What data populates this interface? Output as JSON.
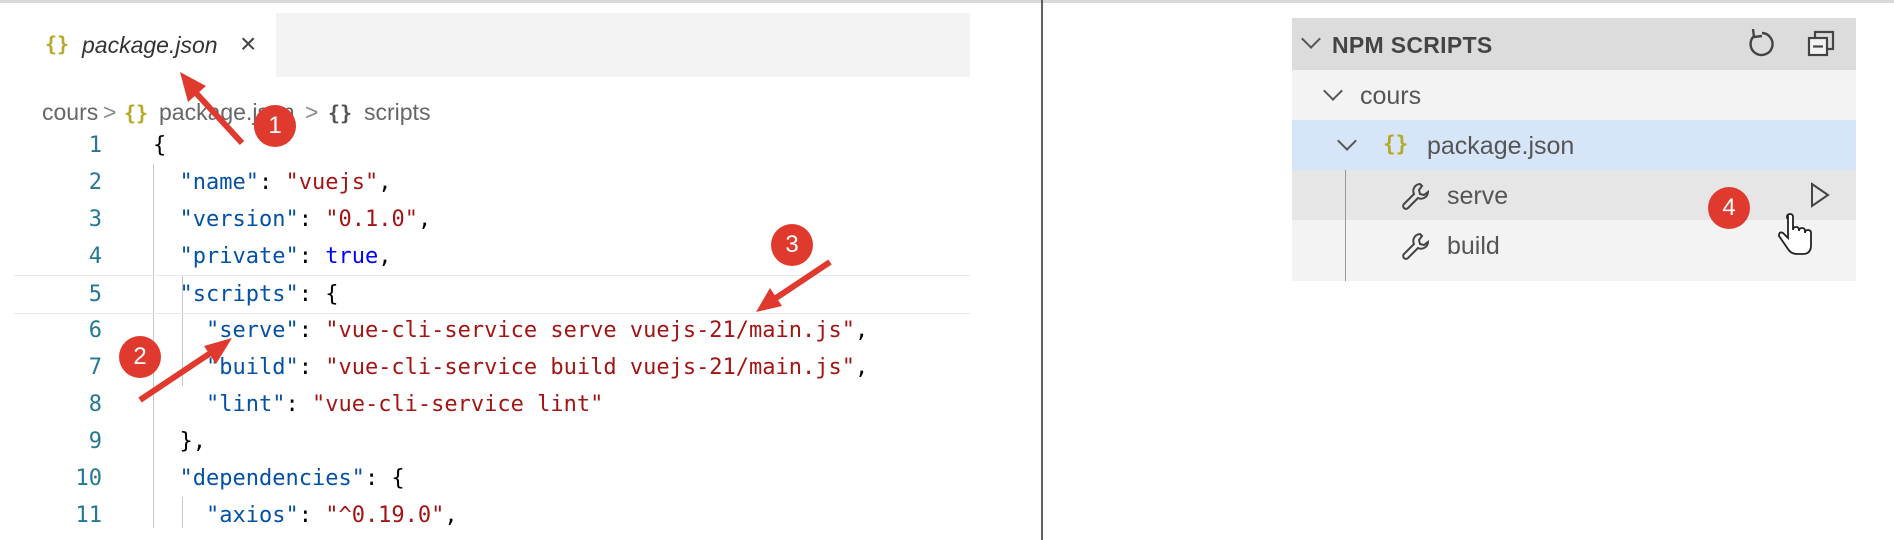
{
  "editor": {
    "tab": {
      "icon": "{}",
      "filename": "package.json",
      "close": "×"
    },
    "breadcrumb": {
      "folder": "cours",
      "file_icon": "{}",
      "file": "package.json",
      "section_icon": "{}",
      "section": "scripts",
      "separator": ">"
    },
    "lines": [
      {
        "n": "1",
        "parts": [
          [
            "p",
            "{"
          ]
        ]
      },
      {
        "n": "2",
        "parts": [
          [
            "p",
            "  "
          ],
          [
            "k",
            "\"name\""
          ],
          [
            "p",
            ": "
          ],
          [
            "s",
            "\"vuejs\""
          ],
          [
            "p",
            ","
          ]
        ]
      },
      {
        "n": "3",
        "parts": [
          [
            "p",
            "  "
          ],
          [
            "k",
            "\"version\""
          ],
          [
            "p",
            ": "
          ],
          [
            "s",
            "\"0.1.0\""
          ],
          [
            "p",
            ","
          ]
        ]
      },
      {
        "n": "4",
        "parts": [
          [
            "p",
            "  "
          ],
          [
            "k",
            "\"private\""
          ],
          [
            "p",
            ": "
          ],
          [
            "b",
            "true"
          ],
          [
            "p",
            ","
          ]
        ]
      },
      {
        "n": "5",
        "parts": [
          [
            "p",
            "  "
          ],
          [
            "k",
            "\"scripts\""
          ],
          [
            "p",
            ": {"
          ]
        ]
      },
      {
        "n": "6",
        "parts": [
          [
            "p",
            "    "
          ],
          [
            "k",
            "\"serve\""
          ],
          [
            "p",
            ": "
          ],
          [
            "s",
            "\"vue-cli-service serve vuejs-21/main.js\""
          ],
          [
            "p",
            ","
          ]
        ]
      },
      {
        "n": "7",
        "parts": [
          [
            "p",
            "    "
          ],
          [
            "k",
            "\"build\""
          ],
          [
            "p",
            ": "
          ],
          [
            "s",
            "\"vue-cli-service build vuejs-21/main.js\""
          ],
          [
            "p",
            ","
          ]
        ]
      },
      {
        "n": "8",
        "parts": [
          [
            "p",
            "    "
          ],
          [
            "k",
            "\"lint\""
          ],
          [
            "p",
            ": "
          ],
          [
            "s",
            "\"vue-cli-service lint\""
          ]
        ]
      },
      {
        "n": "9",
        "parts": [
          [
            "p",
            "  },"
          ]
        ]
      },
      {
        "n": "10",
        "parts": [
          [
            "p",
            "  "
          ],
          [
            "k",
            "\"dependencies\""
          ],
          [
            "p",
            ": {"
          ]
        ]
      },
      {
        "n": "11",
        "parts": [
          [
            "p",
            "    "
          ],
          [
            "k",
            "\"axios\""
          ],
          [
            "p",
            ": "
          ],
          [
            "s",
            "\"^0.19.0\""
          ],
          [
            "p",
            ","
          ]
        ]
      }
    ]
  },
  "npm_panel": {
    "title": "NPM SCRIPTS",
    "refresh_icon": "refresh-icon",
    "collapse_icon": "collapse-all-icon",
    "folder": "cours",
    "file_icon": "{}",
    "file": "package.json",
    "scripts": [
      "serve",
      "build"
    ]
  },
  "annotations": [
    "1",
    "2",
    "3",
    "4"
  ],
  "colors": {
    "key": "#0451a5",
    "string": "#a31515",
    "keyword": "#0000ff",
    "line_number": "#237893",
    "badge": "#e03a2f",
    "selected_row": "#d6e6f8"
  }
}
